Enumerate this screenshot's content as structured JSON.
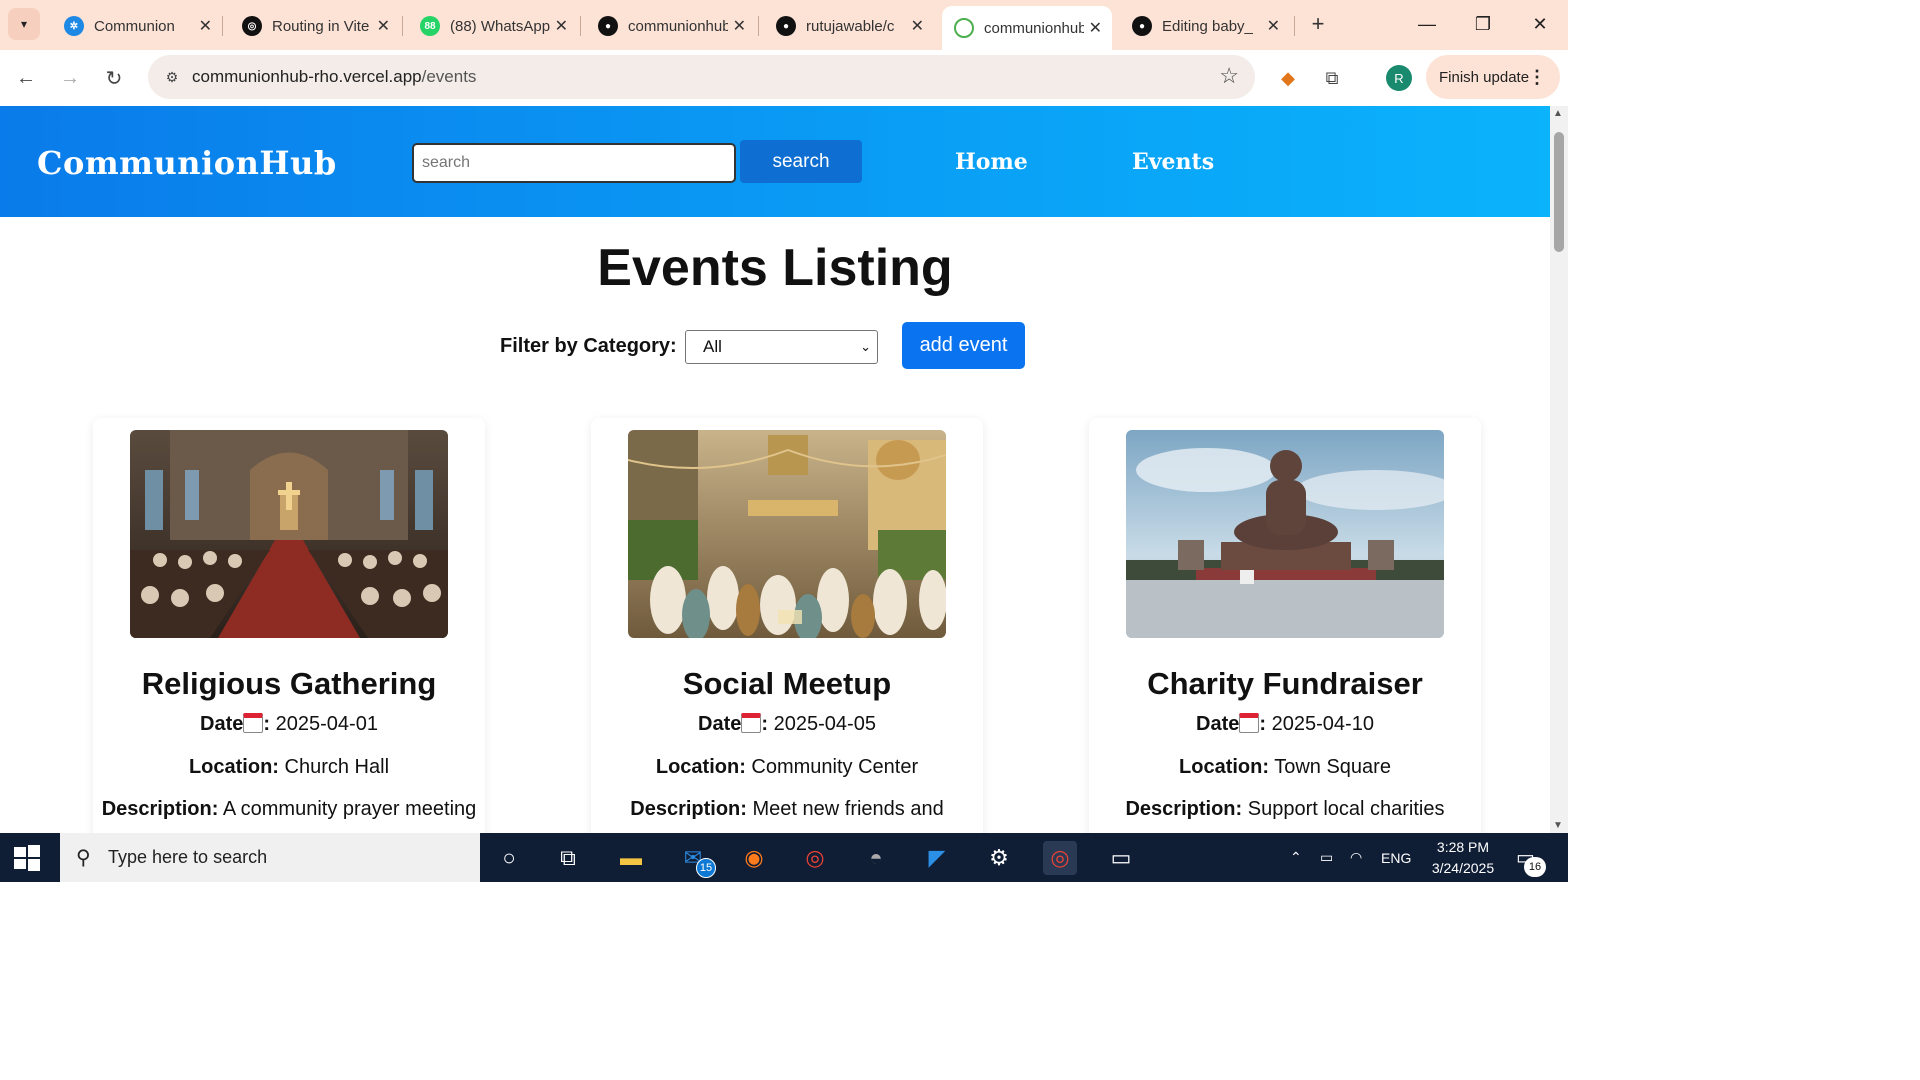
{
  "browser": {
    "tabs": [
      {
        "title": "Communion",
        "favicon": "communion-logo-icon",
        "color": "#1e88e5"
      },
      {
        "title": "Routing in Vite",
        "favicon": "openai-icon",
        "color": "#111111"
      },
      {
        "title": "(88) WhatsApp",
        "favicon": "whatsapp-icon",
        "color": "#25d366",
        "badge": "88"
      },
      {
        "title": "communionhub",
        "favicon": "github-icon",
        "color": "#111111"
      },
      {
        "title": "rutujawable/c",
        "favicon": "github-icon",
        "color": "#111111"
      },
      {
        "title": "communionhub",
        "favicon": "globe-icon",
        "color": "#4caf50",
        "active": true
      },
      {
        "title": "Editing baby_",
        "favicon": "github-icon",
        "color": "#111111"
      }
    ],
    "address": {
      "host": "communionhub-rho.vercel.app",
      "path": "/events"
    },
    "profile_initial": "R",
    "finish_update_label": "Finish update"
  },
  "site": {
    "brand": "CommunionHub",
    "search_placeholder": "search",
    "search_button": "search",
    "nav": [
      "Home",
      "Events"
    ],
    "header_color": "#0a8ff0"
  },
  "page": {
    "title": "Events Listing",
    "filter_label": "Filter by Category:",
    "filter_value": "All",
    "add_button": "add event",
    "labels": {
      "date": "Date",
      "location": "Location:",
      "description": "Description:"
    },
    "events": [
      {
        "name": "Religious Gathering",
        "date": "2025-04-01",
        "location": "Church Hall",
        "description": "A community prayer meeting",
        "image": "church-interior"
      },
      {
        "name": "Social Meetup",
        "date": "2025-04-05",
        "location": "Community Center",
        "description": "Meet new friends and",
        "image": "eid-festival"
      },
      {
        "name": "Charity Fundraiser",
        "date": "2025-04-10",
        "location": "Town Square",
        "description": "Support local charities",
        "image": "buddha-statue"
      }
    ]
  },
  "taskbar": {
    "search_placeholder": "Type here to search",
    "mail_badge": "15",
    "language": "ENG",
    "time": "3:28 PM",
    "date": "3/24/2025",
    "notifications": "16"
  }
}
